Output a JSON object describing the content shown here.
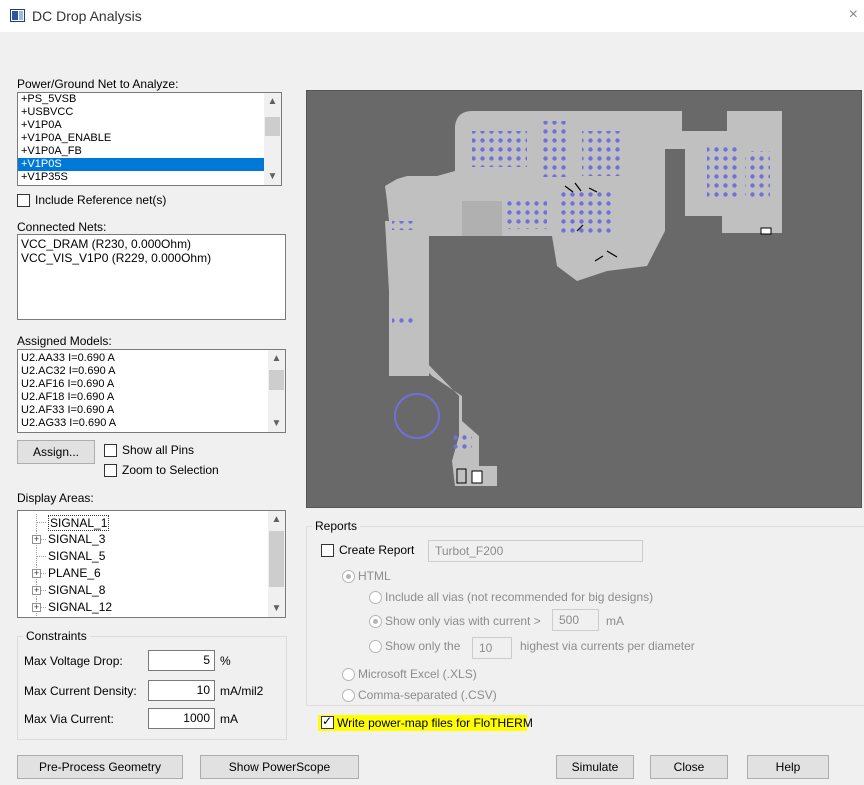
{
  "window": {
    "title": "DC Drop Analysis",
    "close_glyph": "×"
  },
  "power_net": {
    "label": "Power/Ground Net to Analyze:",
    "items": [
      "+PS_5VSB",
      "+USBVCC",
      "+V1P0A",
      "+V1P0A_ENABLE",
      "+V1P0A_FB",
      "+V1P0S",
      "+V1P35S"
    ],
    "selected": "+V1P0S"
  },
  "include_reference": {
    "label": "Include Reference net(s)",
    "checked": false
  },
  "connected_nets": {
    "label": "Connected Nets:",
    "items": [
      "VCC_DRAM (R230, 0.000Ohm)",
      "VCC_VIS_V1P0 (R229, 0.000Ohm)"
    ]
  },
  "assigned_models": {
    "label": "Assigned Models:",
    "items": [
      "U2.AA33 I=0.690 A",
      "U2.AC32 I=0.690 A",
      "U2.AF16 I=0.690 A",
      "U2.AF18 I=0.690 A",
      "U2.AF33 I=0.690 A",
      "U2.AG33 I=0.690 A"
    ]
  },
  "assign_button": "Assign...",
  "show_all_pins": {
    "label": "Show all Pins",
    "checked": false
  },
  "zoom_to_selection": {
    "label": "Zoom to Selection",
    "checked": false
  },
  "display_areas": {
    "label": "Display Areas:",
    "items": [
      {
        "label": "SIGNAL_1",
        "expandable": false,
        "selected": true
      },
      {
        "label": "SIGNAL_3",
        "expandable": true,
        "selected": false
      },
      {
        "label": "SIGNAL_5",
        "expandable": false,
        "selected": false
      },
      {
        "label": "PLANE_6",
        "expandable": true,
        "selected": false
      },
      {
        "label": "SIGNAL_8",
        "expandable": true,
        "selected": false
      },
      {
        "label": "SIGNAL_12",
        "expandable": true,
        "selected": false
      }
    ]
  },
  "constraints": {
    "title": "Constraints",
    "max_voltage_drop": {
      "label": "Max Voltage Drop:",
      "value": "5",
      "unit": "%"
    },
    "max_current_density": {
      "label": "Max Current Density:",
      "value": "10",
      "unit": "mA/mil2"
    },
    "max_via_current": {
      "label": "Max Via Current:",
      "value": "1000",
      "unit": "mA"
    }
  },
  "reports": {
    "title": "Reports",
    "create_report": {
      "label": "Create Report",
      "checked": false
    },
    "report_name": "Turbot_F200",
    "html": {
      "label": "HTML",
      "selected": true
    },
    "include_all_vias": {
      "label": "Include all vias (not recommended for big designs)",
      "selected": false
    },
    "show_only_vias": {
      "label": "Show only vias with current >",
      "value": "500",
      "unit": "mA",
      "selected": true
    },
    "show_only_the": {
      "label": "Show only the",
      "value": "10",
      "suffix": "highest via currents per diameter",
      "selected": false
    },
    "excel": {
      "label": "Microsoft Excel (.XLS)",
      "selected": false
    },
    "csv": {
      "label": "Comma-separated (.CSV)",
      "selected": false
    }
  },
  "flotherm": {
    "label": "Write power-map files for FloTHERM",
    "checked": true,
    "highlight": "#ffff00"
  },
  "buttons": {
    "preprocess": "Pre-Process Geometry",
    "powerscope": "Show PowerScope",
    "simulate": "Simulate",
    "close": "Close",
    "help": "Help"
  },
  "colors": {
    "board": "#c0c0c0",
    "background": "#696969",
    "via": "#7070dd",
    "selection": "#0078d7"
  }
}
